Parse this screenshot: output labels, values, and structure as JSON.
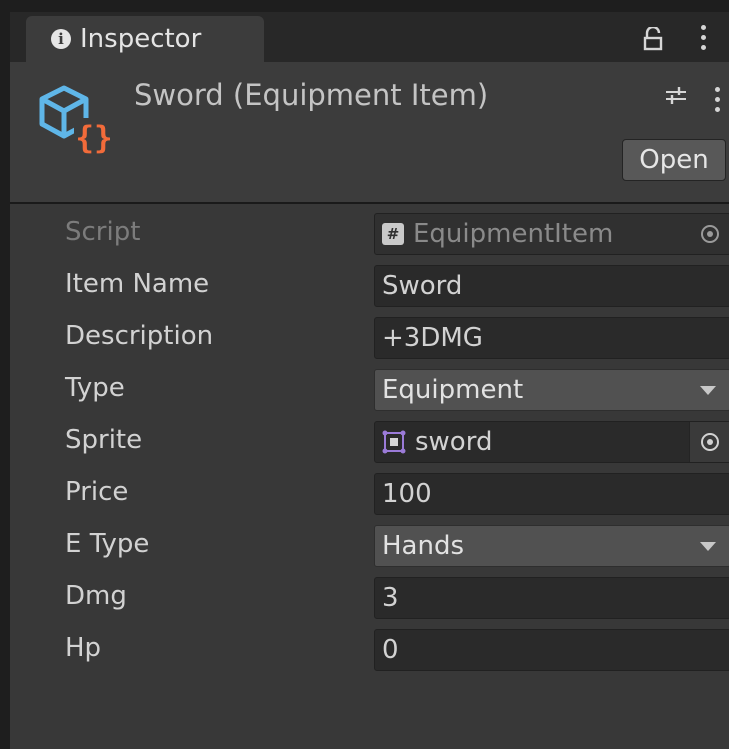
{
  "window": {
    "tab_title": "Inspector",
    "icons": {
      "tab": "info-icon",
      "lock": "lock-icon",
      "menu": "kebab-menu-icon"
    }
  },
  "header": {
    "asset_title": "Sword (Equipment Item)",
    "open_label": "Open",
    "icons": {
      "asset": "scriptable-object-icon",
      "settings": "settings-sliders-icon"
    }
  },
  "fields": {
    "script": {
      "label": "Script",
      "value": "EquipmentItem"
    },
    "item_name": {
      "label": "Item Name",
      "value": "Sword"
    },
    "description": {
      "label": "Description",
      "value": "+3DMG"
    },
    "type": {
      "label": "Type",
      "value": "Equipment"
    },
    "sprite": {
      "label": "Sprite",
      "value": "sword"
    },
    "price": {
      "label": "Price",
      "value": "100"
    },
    "e_type": {
      "label": "E Type",
      "value": "Hands"
    },
    "dmg": {
      "label": "Dmg",
      "value": "3"
    },
    "hp": {
      "label": "Hp",
      "value": "0"
    }
  },
  "colors": {
    "panel_bg": "#383838",
    "header_bg": "#3c3c3c",
    "field_bg": "#2a2a2a",
    "dropdown_bg": "#515151",
    "icon_blue": "#5fb6e8",
    "icon_orange": "#f26b3a",
    "sprite_purple": "#9b7bd8"
  }
}
